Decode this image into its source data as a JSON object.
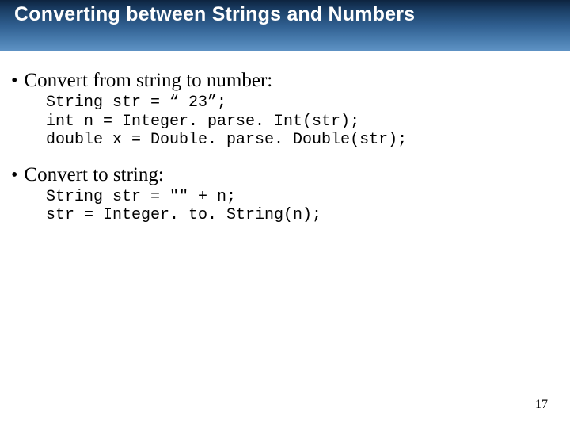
{
  "title": "Converting between Strings and Numbers",
  "section1": {
    "heading": "Convert from string to number:",
    "code_line1": "String str = “ 23”;",
    "code_line2": "int n = Integer. parse. Int(str);",
    "code_line3": "double x = Double. parse. Double(str);"
  },
  "section2": {
    "heading": "Convert to string:",
    "code_line1": "String str = \"\" + n;",
    "code_line2": "str = Integer. to. String(n);"
  },
  "page_number": "17"
}
